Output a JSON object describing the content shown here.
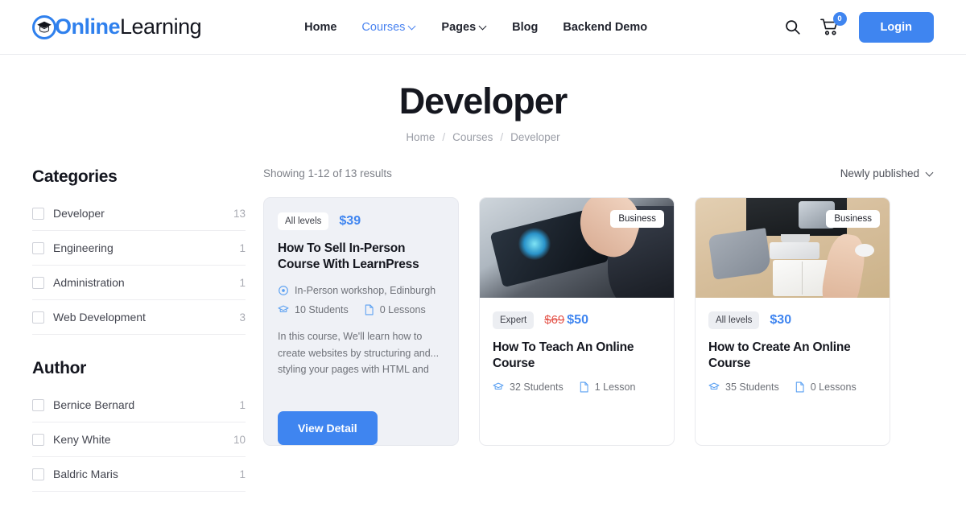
{
  "header": {
    "logo": {
      "brand_blue": "Online",
      "brand_dark": "Learning",
      "icon": "graduation-cap-icon"
    },
    "nav": [
      {
        "label": "Home",
        "has_dropdown": false,
        "active": false
      },
      {
        "label": "Courses",
        "has_dropdown": true,
        "active": true
      },
      {
        "label": "Pages",
        "has_dropdown": true,
        "active": false
      },
      {
        "label": "Blog",
        "has_dropdown": false,
        "active": false
      },
      {
        "label": "Backend Demo",
        "has_dropdown": false,
        "active": false
      }
    ],
    "search_icon": "search-icon",
    "cart_icon": "cart-icon",
    "cart_count": "0",
    "login_label": "Login"
  },
  "page": {
    "title": "Developer",
    "breadcrumb": {
      "home": "Home",
      "sep1": "/",
      "courses": "Courses",
      "sep2": "/",
      "current": "Developer"
    }
  },
  "sidebar": {
    "categories_title": "Categories",
    "categories": [
      {
        "label": "Developer",
        "count": "13"
      },
      {
        "label": "Engineering",
        "count": "1"
      },
      {
        "label": "Administration",
        "count": "1"
      },
      {
        "label": "Web Development",
        "count": "3"
      }
    ],
    "author_title": "Author",
    "authors": [
      {
        "label": "Bernice Bernard",
        "count": "1"
      },
      {
        "label": "Keny White",
        "count": "10"
      },
      {
        "label": "Baldric Maris",
        "count": "1"
      }
    ]
  },
  "results": {
    "showing": "Showing 1-12 of 13 results",
    "sort_label": "Newly published",
    "sort_icon": "chevron-down-icon"
  },
  "courses": [
    {
      "level": "All levels",
      "price": "$39",
      "price_old": "",
      "title": "How To Sell In-Person Course With LearnPress",
      "location_icon": "location-pin-icon",
      "location": "In-Person workshop, Edinburgh",
      "students_icon": "students-icon",
      "students": "10 Students",
      "lessons_icon": "lesson-doc-icon",
      "lessons": "0 Lessons",
      "description": "In this course, We'll learn how to create websites by structuring and... styling your pages with HTML and",
      "button_label": "View Detail",
      "category_tag": "",
      "featured": true
    },
    {
      "level": "Expert",
      "price": "$50",
      "price_old": "$69",
      "title": "How To Teach An Online Course",
      "location_icon": "",
      "location": "",
      "students_icon": "students-icon",
      "students": "32 Students",
      "lessons_icon": "lesson-doc-icon",
      "lessons": "1 Lesson",
      "description": "",
      "button_label": "",
      "category_tag": "Business",
      "featured": false
    },
    {
      "level": "All levels",
      "price": "$30",
      "price_old": "",
      "title": "How to Create An Online Course",
      "location_icon": "",
      "location": "",
      "students_icon": "students-icon",
      "students": "35 Students",
      "lessons_icon": "lesson-doc-icon",
      "lessons": "0 Lessons",
      "description": "",
      "button_label": "",
      "category_tag": "Business",
      "featured": false
    }
  ],
  "colors": {
    "accent": "#3f85f0",
    "sale": "#e4544a",
    "featured_bg": "#eff1f6"
  }
}
